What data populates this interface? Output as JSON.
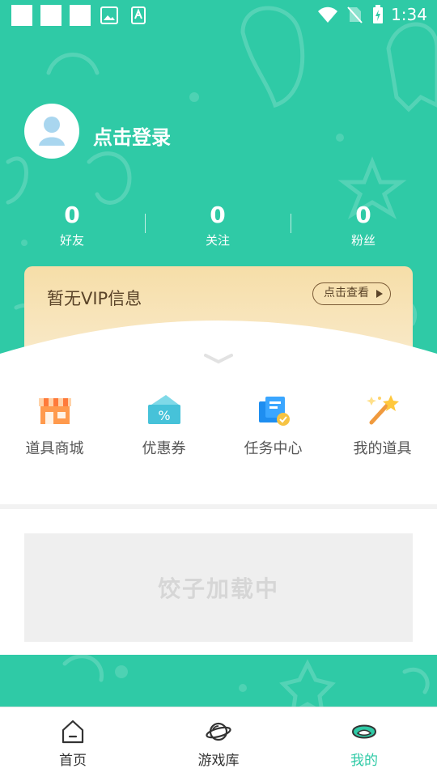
{
  "status_bar": {
    "time": "1:34"
  },
  "profile": {
    "login_text": "点击登录"
  },
  "stats": [
    {
      "value": "0",
      "label": "好友"
    },
    {
      "value": "0",
      "label": "关注"
    },
    {
      "value": "0",
      "label": "粉丝"
    }
  ],
  "vip": {
    "text": "暂无VIP信息",
    "button": "点击查看"
  },
  "menu": [
    {
      "label": "道具商城",
      "icon": "shop-icon"
    },
    {
      "label": "优惠券",
      "icon": "coupon-icon"
    },
    {
      "label": "任务中心",
      "icon": "task-icon"
    },
    {
      "label": "我的道具",
      "icon": "magic-wand-icon"
    }
  ],
  "loading": {
    "text": "饺子加载中"
  },
  "nav": [
    {
      "label": "首页",
      "icon": "home-icon",
      "active": false
    },
    {
      "label": "游戏库",
      "icon": "planet-icon",
      "active": false
    },
    {
      "label": "我的",
      "icon": "mine-icon",
      "active": true
    }
  ],
  "colors": {
    "accent": "#2fcaa6",
    "vip_bg": "#f6dea8",
    "panel": "#ffffff"
  }
}
